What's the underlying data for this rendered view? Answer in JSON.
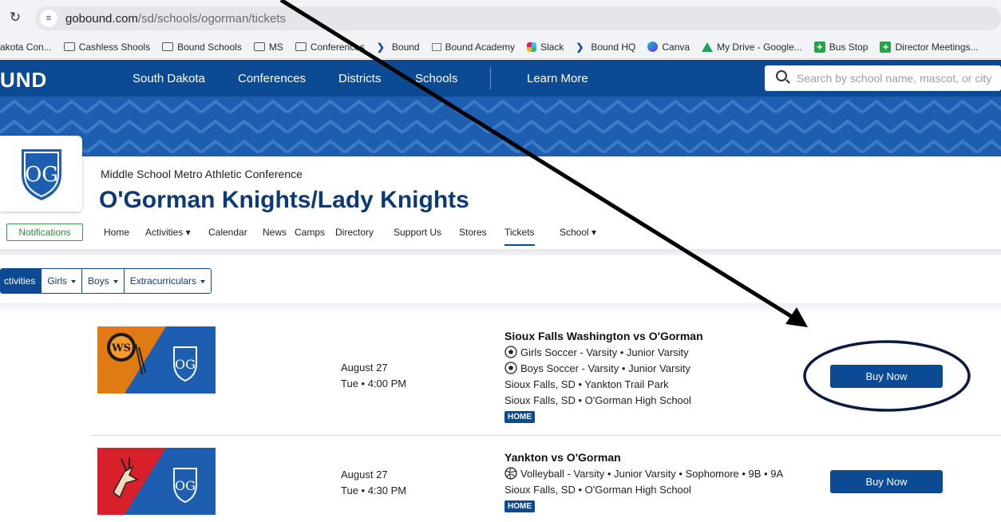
{
  "browser": {
    "url_host": "gobound.com",
    "url_path": "/sd/schools/ogorman/tickets",
    "bookmarks": [
      {
        "label": "akota Con...",
        "icon": "none"
      },
      {
        "label": "Cashless Shools",
        "icon": "folder-icon"
      },
      {
        "label": "Bound Schools",
        "icon": "folder-icon"
      },
      {
        "label": "MS",
        "icon": "folder-icon"
      },
      {
        "label": "Conferences",
        "icon": "folder-icon"
      },
      {
        "label": "Bound",
        "icon": "bound-icon"
      },
      {
        "label": "Bound Academy",
        "icon": "book-icon"
      },
      {
        "label": "Slack",
        "icon": "slack-icon"
      },
      {
        "label": "Bound HQ",
        "icon": "bound-icon"
      },
      {
        "label": "Canva",
        "icon": "canva-icon"
      },
      {
        "label": "My Drive - Google...",
        "icon": "drive-icon"
      },
      {
        "label": "Bus Stop",
        "icon": "plus-icon"
      },
      {
        "label": "Director Meetings...",
        "icon": "plus-icon"
      }
    ]
  },
  "site": {
    "logo": "UND",
    "nav": [
      "South Dakota",
      "Conferences",
      "Districts",
      "Schools",
      "Learn More"
    ],
    "search_placeholder": "Search by school name, mascot, or city"
  },
  "school": {
    "conference": "Middle School Metro Athletic Conference",
    "name": "O'Gorman Knights/Lady Knights",
    "logo_letters": "OG",
    "notifications_label": "Notifications",
    "subnav": [
      "Home",
      "Activities ▾",
      "Calendar",
      "News",
      "Camps",
      "Directory",
      "Support Us",
      "Stores",
      "Tickets",
      "School ▾"
    ],
    "active_subnav": "Tickets"
  },
  "filters": {
    "items": [
      "ctivities",
      "Girls",
      "Boys",
      "Extracurriculars"
    ],
    "active": "ctivities"
  },
  "events": [
    {
      "date": "August 27",
      "time": "Tue  •  4:00 PM",
      "title": "Sioux Falls Washington vs O'Gorman",
      "lines": [
        {
          "icon": "soccer-ball-icon",
          "text": "Girls Soccer - Varsity • Junior Varsity"
        },
        {
          "icon": "soccer-ball-icon",
          "text": "Boys Soccer - Varsity • Junior Varsity"
        },
        {
          "icon": "none",
          "text": "Sioux Falls, SD • Yankton Trail Park"
        },
        {
          "icon": "none",
          "text": "Sioux Falls, SD • O'Gorman High School"
        }
      ],
      "badge": "HOME",
      "button": "Buy Now",
      "opponent_logo_letters": "WS",
      "opponent_color": "#e07a12"
    },
    {
      "date": "August 27",
      "time": "Tue  •  4:30 PM",
      "title": "Yankton vs O'Gorman",
      "lines": [
        {
          "icon": "volleyball-icon",
          "text": "Volleyball - Varsity • Junior Varsity • Sophomore • 9B • 9A"
        },
        {
          "icon": "none",
          "text": "Sioux Falls, SD • O'Gorman High School"
        }
      ],
      "badge": "HOME",
      "button": "Buy Now",
      "opponent_color": "#d8202a"
    }
  ],
  "colors": {
    "brand_blue": "#0d4a94",
    "banner_blue": "#1d5eb0",
    "title_blue": "#0d3a74",
    "notify_green": "#2f8c3e",
    "annotation": "#000000"
  }
}
